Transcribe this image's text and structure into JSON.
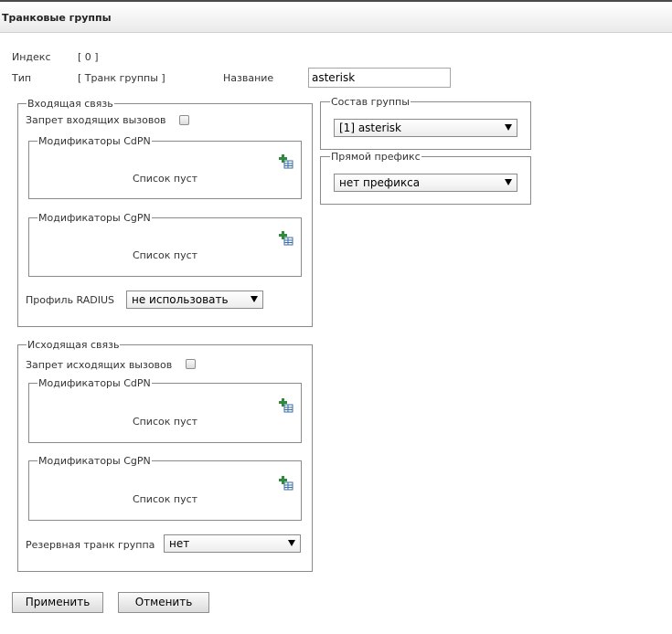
{
  "header": {
    "title": "Транковые группы"
  },
  "info": {
    "index_label": "Индекс",
    "index_value": "[ 0 ]",
    "type_label": "Тип",
    "type_value": "[ Транк группы ]",
    "name_label": "Название",
    "name_value": "asterisk"
  },
  "incoming": {
    "legend": "Входящая связь",
    "block_label": "Запрет входящих вызовов",
    "cdpn": {
      "legend": "Модификаторы CdPN",
      "empty": "Список пуст"
    },
    "cgpn": {
      "legend": "Модификаторы CgPN",
      "empty": "Список пуст"
    },
    "radius_label": "Профиль RADIUS",
    "radius_value": "не использовать"
  },
  "outgoing": {
    "legend": "Исходящая связь",
    "block_label": "Запрет исходящих вызовов",
    "cdpn": {
      "legend": "Модификаторы CdPN",
      "empty": "Список пуст"
    },
    "cgpn": {
      "legend": "Модификаторы CgPN",
      "empty": "Список пуст"
    },
    "reserve_label": "Резервная транк группа",
    "reserve_value": "нет"
  },
  "group": {
    "legend": "Состав группы",
    "value": "[1] asterisk"
  },
  "prefix": {
    "legend": "Прямой префикс",
    "value": "нет префикса"
  },
  "buttons": {
    "apply": "Применить",
    "cancel": "Отменить"
  },
  "icons": {
    "add": "add-table-icon"
  },
  "colors": {
    "icon_plus": "#2e8b3c",
    "icon_table": "#3a6ea5"
  }
}
